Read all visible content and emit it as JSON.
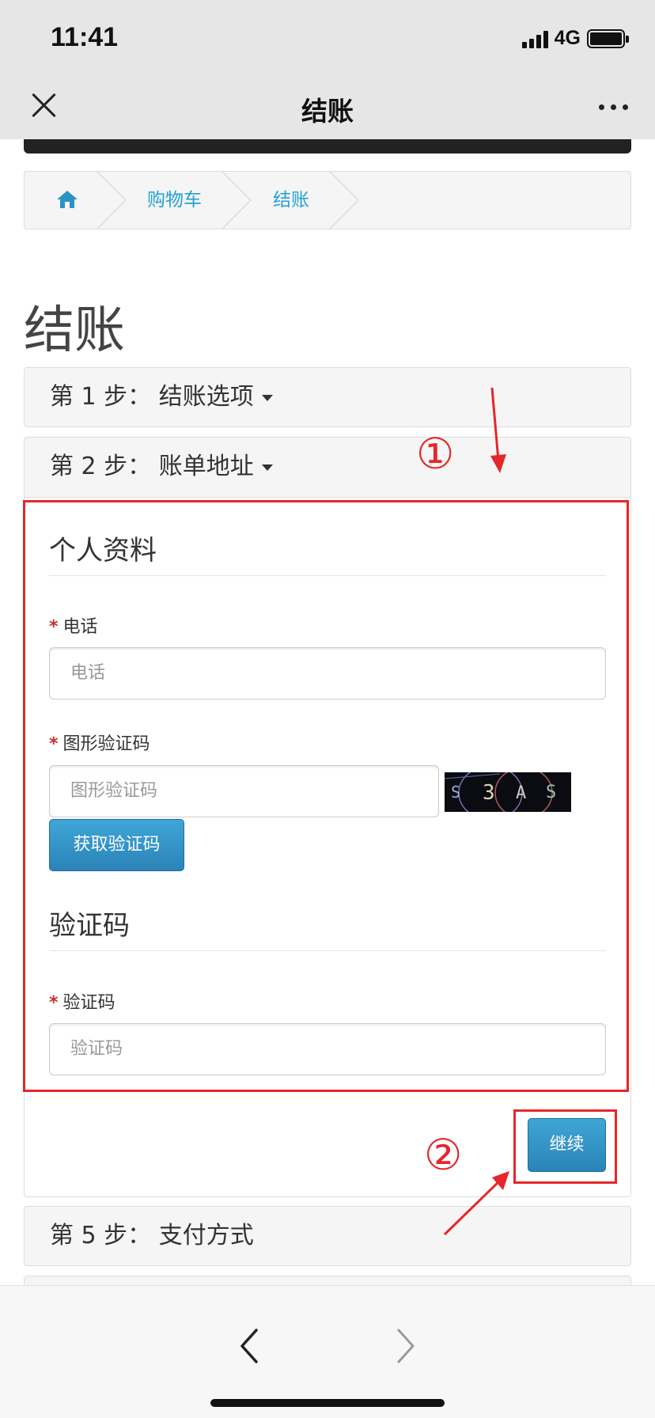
{
  "status_bar": {
    "time": "11:41",
    "network": "4G"
  },
  "nav": {
    "title": "结账"
  },
  "breadcrumb": {
    "items": [
      "购物车",
      "结账"
    ]
  },
  "page_title": "结账",
  "steps": {
    "step1": "第 1 步：  结账选项",
    "step2": "第 2 步：  账单地址",
    "step5": "第 5 步：  支付方式"
  },
  "form": {
    "section_personal": "个人资料",
    "phone_label": "电话",
    "phone_placeholder": "电话",
    "captcha_label": "图形验证码",
    "captcha_placeholder": "图形验证码",
    "captcha_chars": [
      "S",
      "3",
      "A",
      "S"
    ],
    "get_code_button": "获取验证码",
    "section_code": "验证码",
    "code_label": "验证码",
    "code_placeholder": "验证码",
    "required_mark": "*"
  },
  "continue_button": "继续",
  "annotations": {
    "marker1": "①",
    "marker2": "②"
  },
  "colors": {
    "accent": "#23a1d1",
    "button": "#2b83b8",
    "highlight": "#e6262b"
  }
}
